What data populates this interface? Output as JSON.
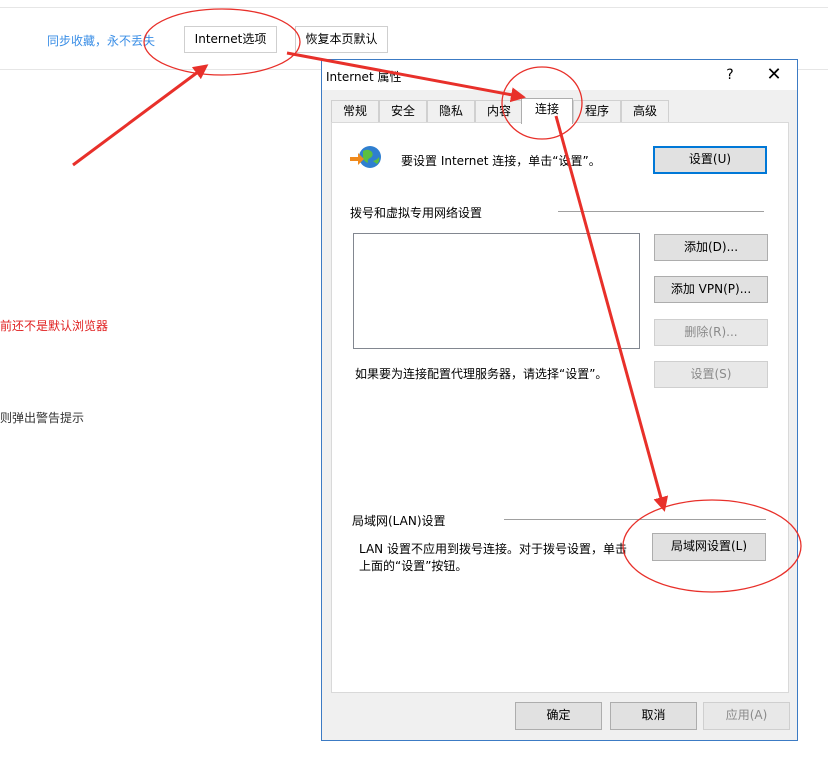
{
  "background_page": {
    "sync_link": "同步收藏，永不丢失",
    "internet_options_button": "Internet选项",
    "restore_default_button": "恢复本页默认",
    "red_notice": "前还不是默认浏览器",
    "warning_text": "则弹出警告提示"
  },
  "dialog": {
    "title": "Internet 属性",
    "help_glyph": "?",
    "close_glyph": "✕",
    "tabs": [
      {
        "label": "常规"
      },
      {
        "label": "安全"
      },
      {
        "label": "隐私"
      },
      {
        "label": "内容"
      },
      {
        "label": "连接"
      },
      {
        "label": "程序"
      },
      {
        "label": "高级"
      }
    ],
    "active_tab": "连接",
    "setup": {
      "text": "要设置 Internet 连接，单击“设置”。",
      "button": "设置(U)"
    },
    "dialup": {
      "heading": "拨号和虚拟专用网络设置",
      "add_button": "添加(D)...",
      "add_vpn_button": "添加 VPN(P)...",
      "remove_button": "删除(R)...",
      "settings_button": "设置(S)",
      "proxy_text": "如果要为连接配置代理服务器，请选择“设置”。"
    },
    "lan": {
      "heading": "局域网(LAN)设置",
      "text_line1": "LAN 设置不应用到拨号连接。对于拨号设置，单击",
      "text_line2": "上面的“设置”按钮。",
      "button": "局域网设置(L)"
    },
    "footer": {
      "ok_button": "确定",
      "cancel_button": "取消",
      "apply_button": "应用(A)"
    }
  },
  "colors": {
    "annotation_red": "#e8302a",
    "link_blue": "#3a8ee6",
    "dialog_border": "#3c7bc4",
    "focus_blue": "#0078d7"
  }
}
